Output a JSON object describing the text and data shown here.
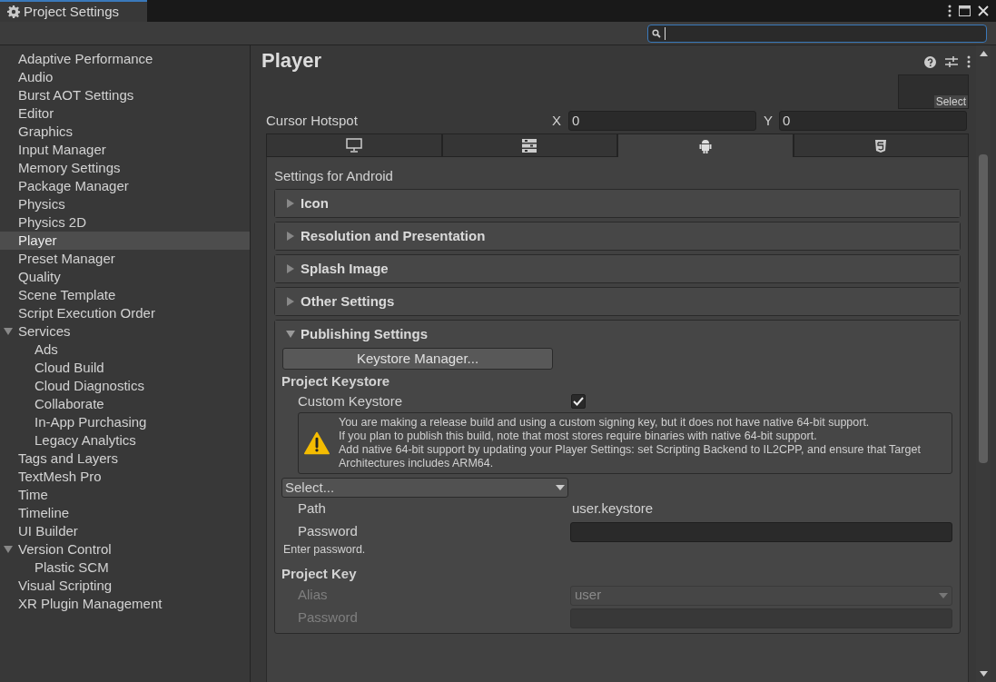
{
  "window": {
    "title": "Project Settings"
  },
  "sidebar": {
    "items": [
      {
        "label": "Adaptive Performance",
        "selected": false
      },
      {
        "label": "Audio",
        "selected": false
      },
      {
        "label": "Burst AOT Settings",
        "selected": false
      },
      {
        "label": "Editor",
        "selected": false
      },
      {
        "label": "Graphics",
        "selected": false
      },
      {
        "label": "Input Manager",
        "selected": false
      },
      {
        "label": "Memory Settings",
        "selected": false
      },
      {
        "label": "Package Manager",
        "selected": false
      },
      {
        "label": "Physics",
        "selected": false
      },
      {
        "label": "Physics 2D",
        "selected": false
      },
      {
        "label": "Player",
        "selected": true
      },
      {
        "label": "Preset Manager",
        "selected": false
      },
      {
        "label": "Quality",
        "selected": false
      },
      {
        "label": "Scene Template",
        "selected": false
      },
      {
        "label": "Script Execution Order",
        "selected": false
      },
      {
        "label": "Services",
        "selected": false,
        "expanded": true,
        "children": [
          {
            "label": "Ads",
            "selected": false
          },
          {
            "label": "Cloud Build",
            "selected": false
          },
          {
            "label": "Cloud Diagnostics",
            "selected": false
          },
          {
            "label": "Collaborate",
            "selected": false
          },
          {
            "label": "In-App Purchasing",
            "selected": false
          },
          {
            "label": "Legacy Analytics",
            "selected": false
          }
        ]
      },
      {
        "label": "Tags and Layers",
        "selected": false
      },
      {
        "label": "TextMesh Pro",
        "selected": false
      },
      {
        "label": "Time",
        "selected": false
      },
      {
        "label": "Timeline",
        "selected": false
      },
      {
        "label": "UI Builder",
        "selected": false
      },
      {
        "label": "Version Control",
        "selected": false,
        "expanded": true,
        "children": [
          {
            "label": "Plastic SCM",
            "selected": false
          }
        ]
      },
      {
        "label": "Visual Scripting",
        "selected": false
      },
      {
        "label": "XR Plugin Management",
        "selected": false
      }
    ]
  },
  "inspector": {
    "title": "Player",
    "select_button": "Select",
    "cursor_hotspot": {
      "label": "Cursor Hotspot",
      "x_label": "X",
      "x_value": "0",
      "y_label": "Y",
      "y_value": "0"
    },
    "platform_tabs": [
      {
        "kind": "desktop",
        "selected": false
      },
      {
        "kind": "server",
        "selected": false
      },
      {
        "kind": "android",
        "selected": true
      },
      {
        "kind": "html5",
        "selected": false
      }
    ],
    "settings_title": "Settings for Android",
    "sections": [
      {
        "label": "Icon",
        "expanded": false
      },
      {
        "label": "Resolution and Presentation",
        "expanded": false
      },
      {
        "label": "Splash Image",
        "expanded": false
      },
      {
        "label": "Other Settings",
        "expanded": false
      },
      {
        "label": "Publishing Settings",
        "expanded": true
      }
    ],
    "publishing": {
      "keystore_manager_button": "Keystore Manager...",
      "project_keystore_heading": "Project Keystore",
      "custom_keystore": {
        "label": "Custom Keystore",
        "checked": true
      },
      "warning": [
        "You are making a release build and using a custom signing key, but it does not have native 64-bit support.",
        "If you plan to publish this build, note that most stores require binaries with native 64-bit support.",
        "Add native 64-bit support by updating your Player Settings: set Scripting Backend to IL2CPP, and ensure that Target Architectures includes ARM64."
      ],
      "keystore_dropdown": "Select...",
      "path": {
        "label": "Path",
        "value": "user.keystore"
      },
      "password": {
        "label": "Password",
        "disabled": false
      },
      "password_hint": "Enter password.",
      "project_key_heading": "Project Key",
      "alias": {
        "label": "Alias",
        "value": "user",
        "disabled": true
      },
      "key_password": {
        "label": "Password",
        "disabled": true
      }
    }
  }
}
